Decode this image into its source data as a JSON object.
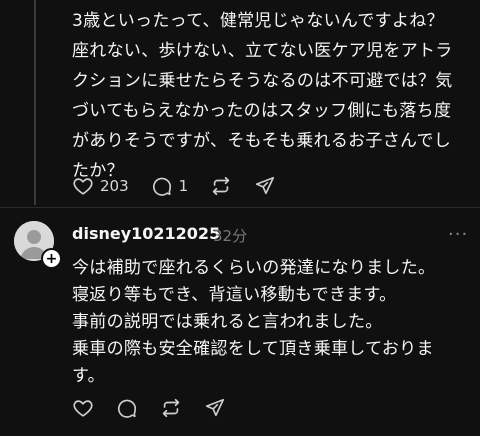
{
  "post1": {
    "text": "3歳といったって、健常児じゃないんですよね？\n座れない、歩けない、立てない医ケア児をアトラ\nクションに乗せたらそうなるのは不可避では？気\nづいてもらえなかったのはスタッフ側にも落ち度\nがありそうですが、そもそも乗れるお子さんでし\nたか？",
    "likes": "203",
    "comments": "1"
  },
  "post2": {
    "username": "disney10212025",
    "time": "32分",
    "more": "···",
    "follow_badge": "+",
    "text": "今は補助で座れるくらいの発達になりました。\n寝返り等もでき、背這い移動もできます。\n事前の説明では乗れると言われました。\n乗車の際も安全確認をして頂き乗車しておりま\nす。"
  },
  "icons": {
    "like": "heart-icon",
    "comment": "comment-icon",
    "repost": "repost-icon",
    "share": "share-icon"
  },
  "colors": {
    "background": "#101010",
    "text": "#f3f5f7",
    "muted": "#777777"
  }
}
